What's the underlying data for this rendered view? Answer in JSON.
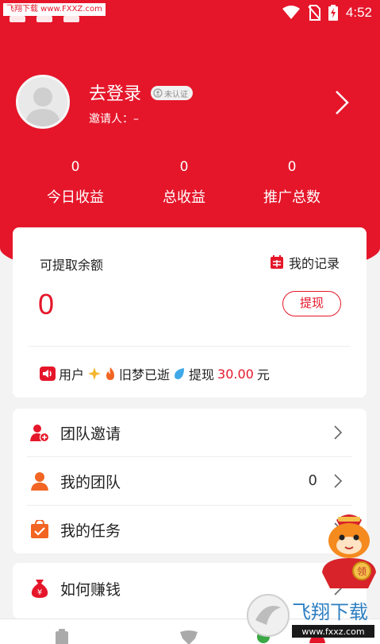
{
  "status_bar": {
    "watermark_label": "飞翔下载 www.FXXZ.com",
    "time": "4:52"
  },
  "profile": {
    "login_text": "去登录",
    "verify_badge": "未认证",
    "inviter": "邀请人：–"
  },
  "stats": [
    {
      "value": "0",
      "label": "今日收益"
    },
    {
      "value": "0",
      "label": "总收益"
    },
    {
      "value": "0",
      "label": "推广总数"
    }
  ],
  "balance": {
    "label": "可提取余额",
    "value": "0",
    "records_label": "我的记录",
    "withdraw_label": "提现",
    "ticker_user": "用户",
    "ticker_name": "旧梦已逝",
    "ticker_action": "提现",
    "ticker_amount": "30.00",
    "ticker_unit": "元"
  },
  "menu": [
    {
      "label": "团队邀请",
      "icon": "add-user-icon"
    },
    {
      "label": "我的团队",
      "icon": "user-icon",
      "count": "0"
    },
    {
      "label": "我的任务",
      "icon": "task-bag-icon"
    },
    {
      "label": "如何赚钱",
      "icon": "money-bag-icon"
    }
  ],
  "mascot_badge": "领",
  "watermark": {
    "logo_text": "飞翔下载",
    "url": "www.fxxz.com"
  },
  "colors": {
    "accent": "#e5162a",
    "background": "#f3f3f3",
    "orange_icon": "#f26522"
  }
}
